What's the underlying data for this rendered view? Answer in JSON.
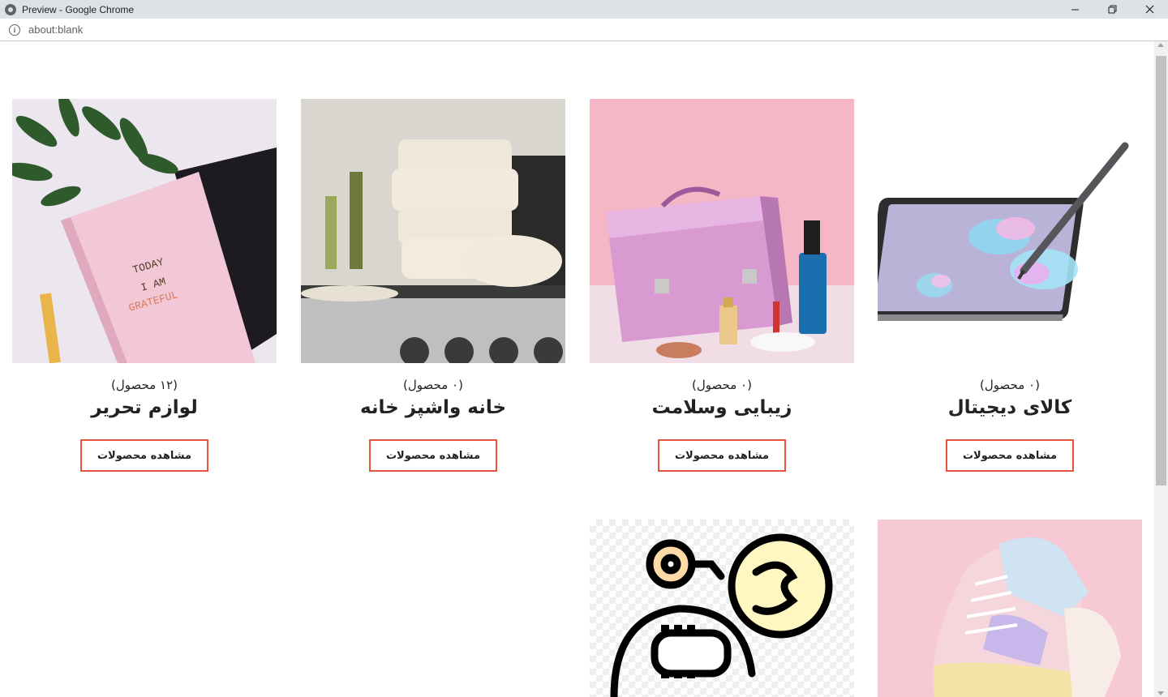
{
  "window": {
    "title": "Preview - Google Chrome"
  },
  "address": {
    "url": "about:blank"
  },
  "categories": [
    {
      "name": "کالای دیجیتال",
      "count": "(۰ محصول)",
      "button": "مشاهده محصولات"
    },
    {
      "name": "زیبایی وسلامت",
      "count": "(۰ محصول)",
      "button": "مشاهده محصولات"
    },
    {
      "name": "خانه واشپز خانه",
      "count": "(۰ محصول)",
      "button": "مشاهده محصولات"
    },
    {
      "name": "لوازم تحریر",
      "count": "(۱۲ محصول)",
      "button": "مشاهده محصولات"
    }
  ],
  "notebook_text": {
    "line1": "TODAY",
    "line2": "I AM",
    "line3": "GRATEFUL"
  },
  "colors": {
    "accent": "#e8533f",
    "text": "#222222"
  }
}
